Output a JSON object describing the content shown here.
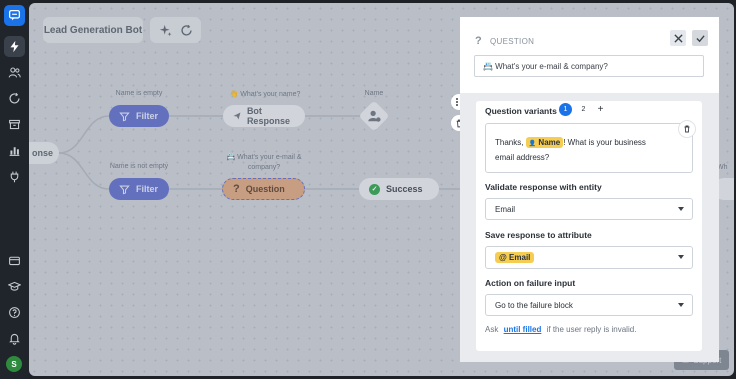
{
  "colors": {
    "accent": "#1a73e8",
    "rail": "#20252b",
    "canvas": "#c7ccd3",
    "filter": "#5f6dc9",
    "question_node": "#d8a57f",
    "attr_tag": "#f6cd53",
    "success": "#30a14e"
  },
  "bot_name": "Lead Generation Bot",
  "flow": {
    "labels": {
      "name_empty": "Name is empty",
      "name_not_empty": "Name is not empty",
      "whats_name": "👋 What's your name?",
      "whats_email": "📇 What's your e-mail & company?",
      "name": "Name"
    },
    "nodes": {
      "filter": "Filter",
      "bot_response": "Bot Response",
      "question": "Question",
      "success": "Success",
      "response_partial": "onse",
      "wh_partial": "Wh"
    }
  },
  "panel": {
    "header": "QUESTION",
    "title": "📇 What's your e-mail & company?",
    "variants_label": "Question variants",
    "variant_tabs": [
      "1",
      "2"
    ],
    "add_label": "+",
    "message": {
      "before": "Thanks,",
      "attr": "Name",
      "after": "! What is your business email address?"
    },
    "validate_label": "Validate response with entity",
    "validate_value": "Email",
    "save_label": "Save response to attribute",
    "save_value": "Email",
    "failure_label": "Action on failure input",
    "failure_value": "Go to the failure block",
    "footer": {
      "pre": "Ask",
      "link": "until filled",
      "post": "if the user reply is invalid."
    }
  },
  "support_label": "Support",
  "avatar_initial": "S"
}
